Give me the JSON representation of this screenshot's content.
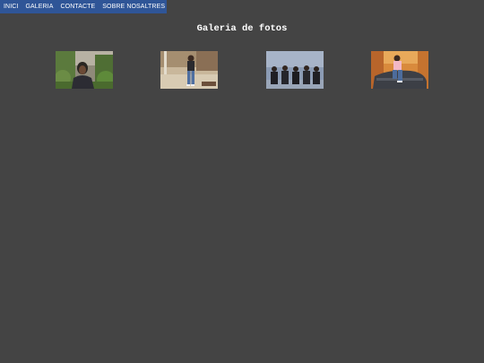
{
  "nav": {
    "items": [
      {
        "label": "INICI"
      },
      {
        "label": "GALERIA"
      },
      {
        "label": "CONTACTE"
      },
      {
        "label": "SOBRE NOSALTRES"
      }
    ],
    "bg_color": "#2f5597"
  },
  "page": {
    "title": "Galeria de fotos",
    "bg_color": "#444444"
  },
  "gallery": {
    "photos": [
      {
        "name": "photo-1"
      },
      {
        "name": "photo-2"
      },
      {
        "name": "photo-3"
      },
      {
        "name": "photo-4"
      }
    ]
  }
}
